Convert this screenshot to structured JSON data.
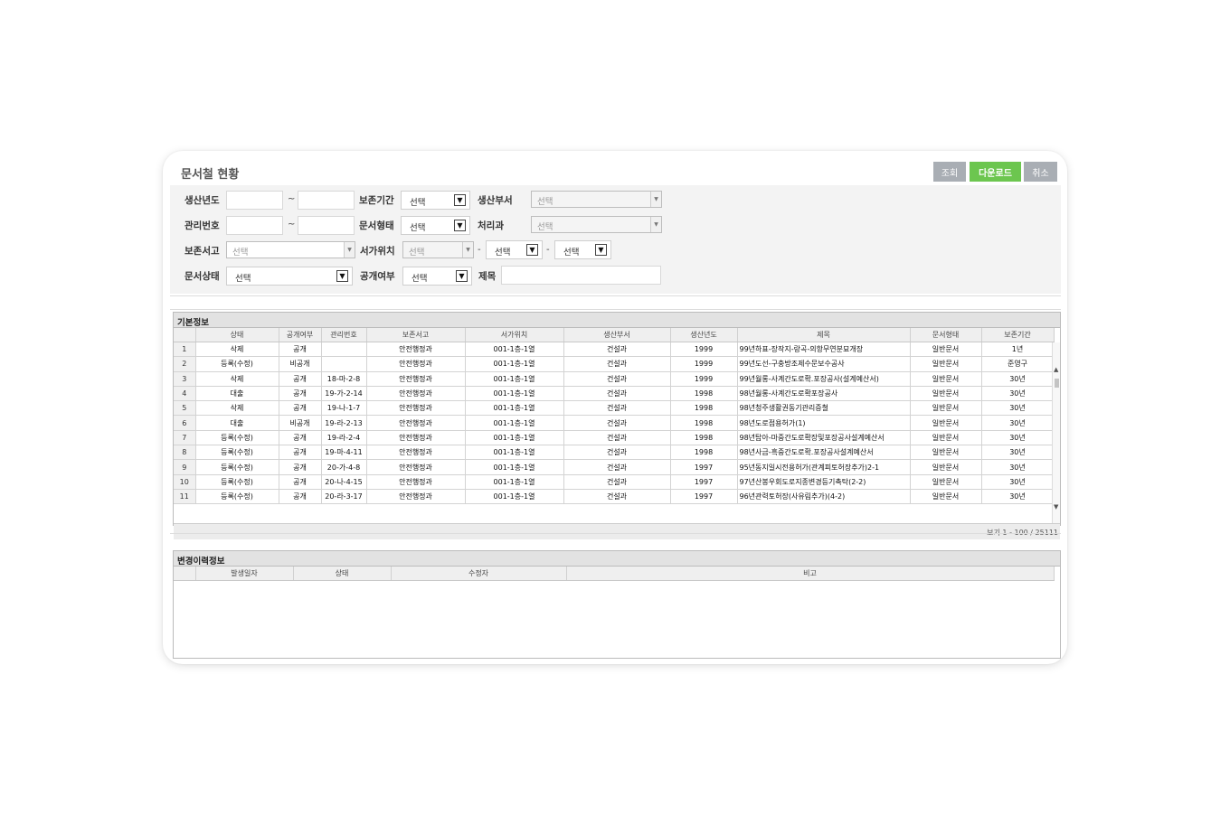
{
  "title": "문서철 현황",
  "buttons": {
    "search": "조회",
    "download": "다운로드",
    "cancel": "취소"
  },
  "filters": {
    "production_year": "생산년도",
    "retention_period": "보존기간",
    "production_dept": "생산부서",
    "management_no": "관리번호",
    "doc_type": "문서형태",
    "processing_dept": "처리과",
    "archive": "보존서고",
    "shelf_location": "서가위치",
    "doc_status": "문서상태",
    "disclosure": "공개여부",
    "subject": "제목",
    "select": "선택",
    "range_sep": "~",
    "hyphen": "-"
  },
  "basic_info": {
    "title": "기본정보",
    "columns": [
      "상태",
      "공개여부",
      "관리번호",
      "보존서고",
      "서가위치",
      "생산부서",
      "생산년도",
      "제목",
      "문서형태",
      "보존기간"
    ],
    "rows": [
      [
        "1",
        "삭제",
        "공개",
        "",
        "안전행정과",
        "001-1층-1열",
        "건설과",
        "1999",
        "99년하표-장작지-랑곡-의항무연분묘개장",
        "일반문서",
        "1년"
      ],
      [
        "2",
        "등록(수정)",
        "비공개",
        "",
        "안전행정과",
        "001-1층-1열",
        "건설과",
        "1999",
        "99년도선-구충방조제수문보수공사",
        "일반문서",
        "준영구"
      ],
      [
        "3",
        "삭제",
        "공개",
        "18-마-2-8",
        "안전행정과",
        "001-1층-1열",
        "건설과",
        "1999",
        "99년월롱-사계간도로확.포장공사(설계예산서)",
        "일반문서",
        "30년"
      ],
      [
        "4",
        "대출",
        "공개",
        "19-가-2-14",
        "안전행정과",
        "001-1층-1열",
        "건설과",
        "1998",
        "98년월롱-사계간도로확포장공사",
        "일반문서",
        "30년"
      ],
      [
        "5",
        "삭제",
        "공개",
        "19-나-1-7",
        "안전행정과",
        "001-1층-1열",
        "건설과",
        "1998",
        "98년청주생활권동기관리증철",
        "일반문서",
        "30년"
      ],
      [
        "6",
        "대출",
        "비공개",
        "19-라-2-13",
        "안전행정과",
        "001-1층-1열",
        "건설과",
        "1998",
        "98년도로점용허가(1)",
        "일반문서",
        "30년"
      ],
      [
        "7",
        "등록(수정)",
        "공개",
        "19-라-2-4",
        "안전행정과",
        "001-1층-1열",
        "건설과",
        "1998",
        "98년탑아-마중간도로확장및포장공사설계예산서",
        "일반문서",
        "30년"
      ],
      [
        "8",
        "등록(수정)",
        "공개",
        "19-마-4-11",
        "안전행정과",
        "001-1층-1열",
        "건설과",
        "1998",
        "98년사금-흑중간도로확.포장공사설계예산서",
        "일반문서",
        "30년"
      ],
      [
        "9",
        "등록(수정)",
        "공개",
        "20-가-4-8",
        "안전행정과",
        "001-1층-1열",
        "건설과",
        "1997",
        "95년동지일시전용허가(관계피토허장추가)2-1",
        "일반문서",
        "30년"
      ],
      [
        "10",
        "등록(수정)",
        "공개",
        "20-나-4-15",
        "안전행정과",
        "001-1층-1열",
        "건설과",
        "1997",
        "97년산봉우회도로지종변경등기촉탁(2-2)",
        "일반문서",
        "30년"
      ],
      [
        "11",
        "등록(수정)",
        "공개",
        "20-라-3-17",
        "안전행정과",
        "001-1층-1열",
        "건설과",
        "1997",
        "96년관력토허장(사유림추가)(4-2)",
        "일반문서",
        "30년"
      ]
    ],
    "pager": "보기 1 - 100 / 25111"
  },
  "history_info": {
    "title": "변경이력정보",
    "columns": [
      "발생일자",
      "상태",
      "수정자",
      "비고"
    ]
  }
}
